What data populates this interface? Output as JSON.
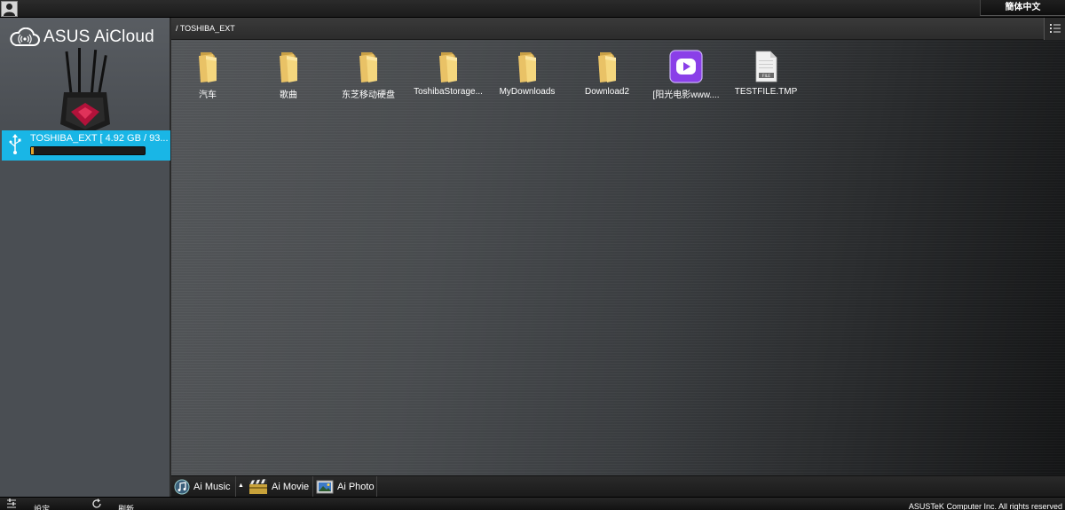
{
  "topbar": {
    "language": "簡体中文",
    "user_icon": "user-icon"
  },
  "sidebar": {
    "logo_text": "ASUS AiCloud",
    "drive": {
      "label": "TOSHIBA_EXT [ 4.92 GB / 93...",
      "usage_fraction": 0.02,
      "bar_color": "#e0a12a",
      "highlight_color": "#19b6e6"
    }
  },
  "pathbar": {
    "path": "/ TOSHIBA_EXT"
  },
  "files": [
    {
      "name": "汽车",
      "type": "folder"
    },
    {
      "name": "歌曲",
      "type": "folder"
    },
    {
      "name": "东芝移动硬盘",
      "type": "folder"
    },
    {
      "name": "ToshibaStorage...",
      "type": "folder"
    },
    {
      "name": "MyDownloads",
      "type": "folder"
    },
    {
      "name": "Download2",
      "type": "folder"
    },
    {
      "name": "[阳光电影www....",
      "type": "video"
    },
    {
      "name": "TESTFILE.TMP",
      "type": "file",
      "badge": "FILE"
    }
  ],
  "apptabs": {
    "music": "Ai Music",
    "movie": "Ai Movie",
    "photo": "Ai Photo"
  },
  "footer": {
    "settings": "設定",
    "refresh": "刷新",
    "copyright": "ASUSTeK Computer Inc. All rights reserved"
  }
}
